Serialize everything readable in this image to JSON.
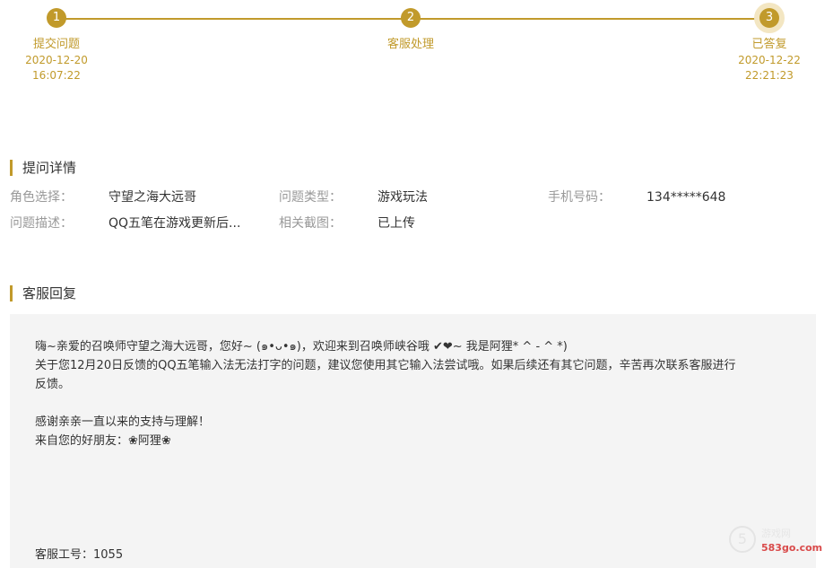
{
  "progress": {
    "steps": [
      {
        "number": "1",
        "label": "提交问题",
        "date": "2020-12-20",
        "time": "16:07:22"
      },
      {
        "number": "2",
        "label": "客服处理",
        "date": "",
        "time": ""
      },
      {
        "number": "3",
        "label": "已答复",
        "date": "2020-12-22",
        "time": "22:21:23"
      }
    ],
    "accent_color": "#c19a2b",
    "current_step": 3
  },
  "details": {
    "title": "提问详情",
    "role_label": "角色选择：",
    "role_value": "守望之海大远哥",
    "type_label": "问题类型：",
    "type_value": "游戏玩法",
    "phone_label": "手机号码：",
    "phone_value": "134*****648",
    "desc_label": "问题描述：",
    "desc_value": "QQ五笔在游戏更新后...",
    "screenshot_label": "相关截图：",
    "screenshot_value": "已上传"
  },
  "reply": {
    "title": "客服回复",
    "line1": "嗨~亲爱的召唤师守望之海大远哥，您好~ (๑•ᴗ•๑)，欢迎来到召唤师峡谷哦 ✔❤~ 我是阿狸* ^ - ^ *)",
    "line2": "关于您12月20日反馈的QQ五笔输入法无法打字的问题，建议您使用其它输入法尝试哦。如果后续还有其它问题，辛苦再次联系客服进行",
    "line3": "反馈。",
    "line4": "感谢亲亲一直以来的支持与理解！",
    "line5": "来自您的好朋友：❀阿狸❀",
    "staff_id": "客服工号：1055"
  },
  "watermark": {
    "logo_glyph": "5",
    "top_text": "游戏网",
    "url": "583go.com"
  }
}
